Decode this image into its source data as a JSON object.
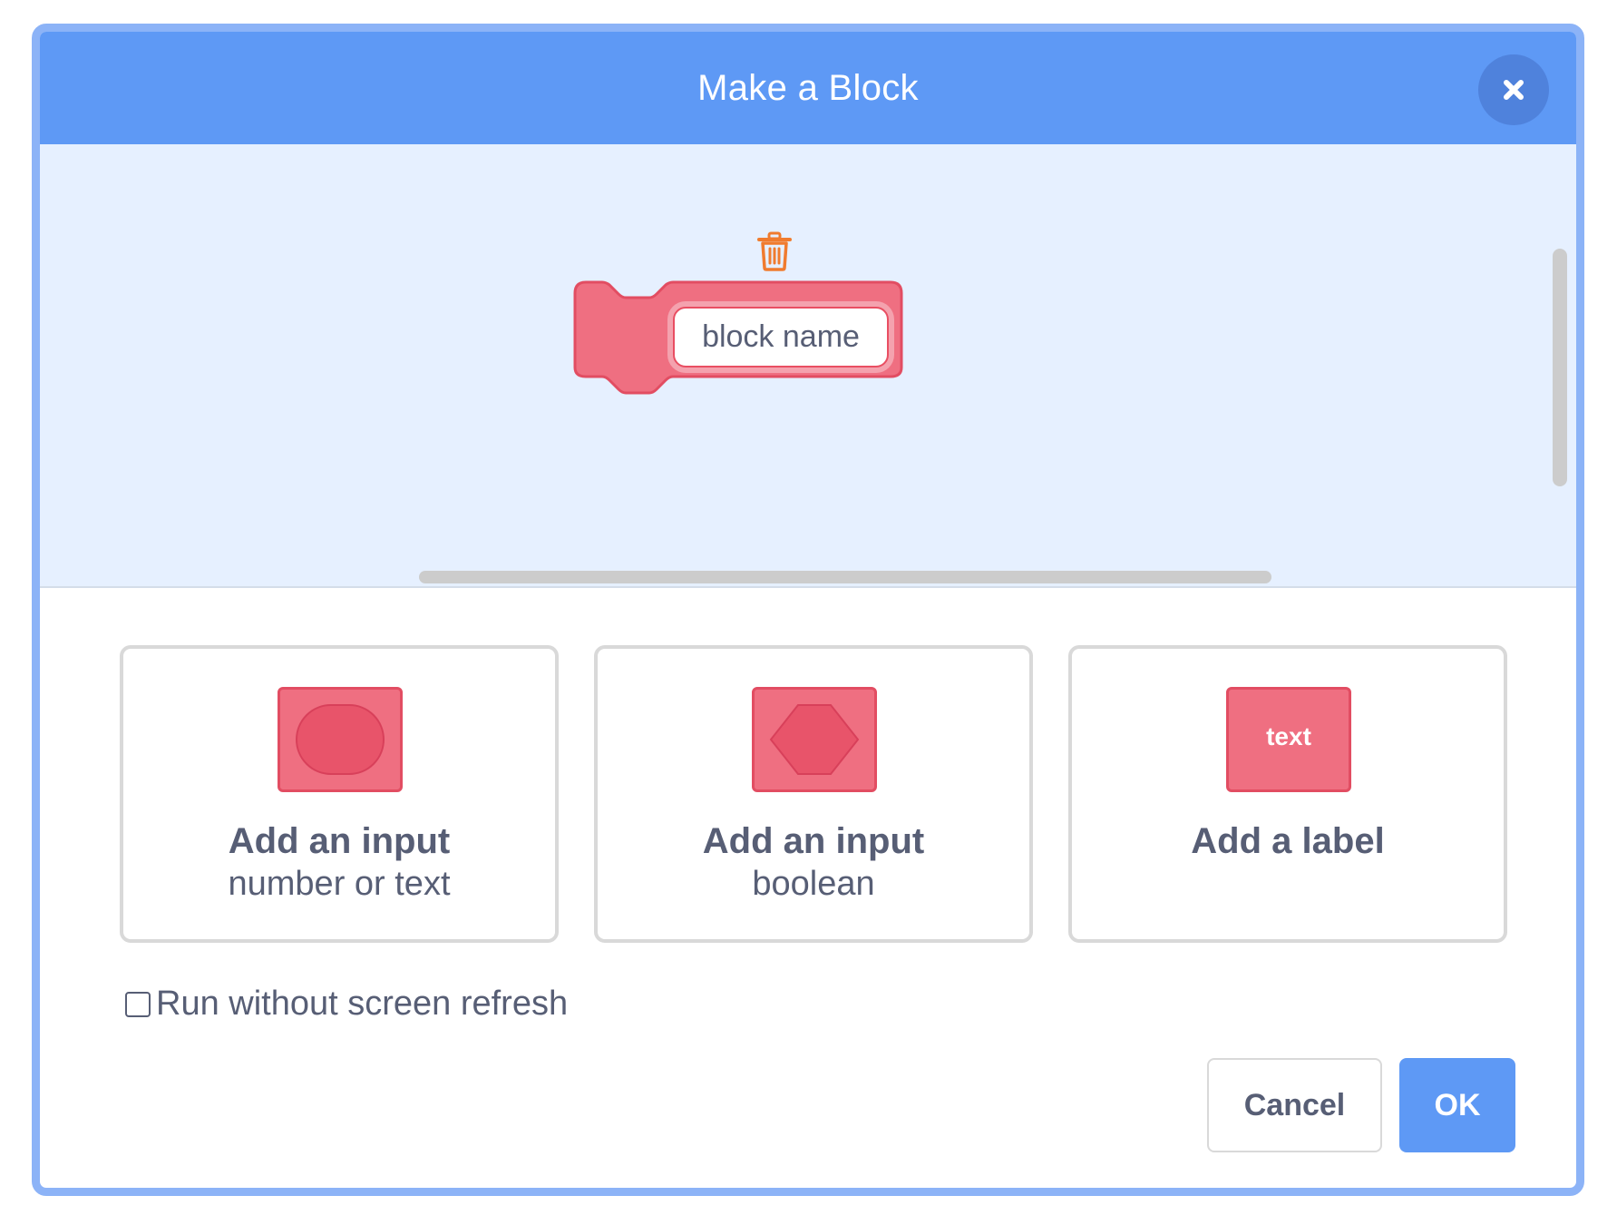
{
  "dialog": {
    "title": "Make a Block",
    "close_icon": "close-x-icon"
  },
  "preview": {
    "block_name_placeholder": "block name",
    "delete_icon": "trash-icon",
    "block_color": "#ef6f81"
  },
  "options": [
    {
      "title": "Add an input",
      "subtitle": "number or text",
      "icon": "round-input-icon"
    },
    {
      "title": "Add an input",
      "subtitle": "boolean",
      "icon": "boolean-input-icon"
    },
    {
      "title": "Add a label",
      "subtitle": "",
      "icon": "label-icon",
      "icon_text": "text"
    }
  ],
  "run_without_refresh": {
    "label": "Run without screen refresh",
    "checked": false
  },
  "buttons": {
    "cancel": "Cancel",
    "ok": "OK"
  },
  "colors": {
    "header": "#5e99f5",
    "accent": "#5e99f5",
    "block": "#ef6f81",
    "block_border": "#e24d62",
    "text": "#575e75",
    "trash": "#f07b2e"
  }
}
